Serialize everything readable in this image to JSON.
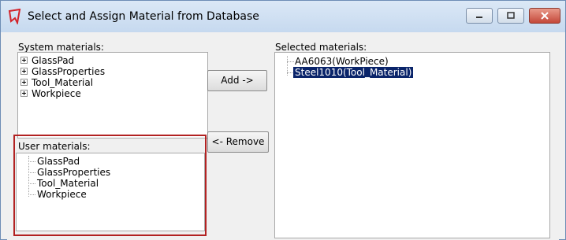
{
  "window": {
    "title": "Select and Assign Material from Database"
  },
  "system_panel": {
    "label": "System materials:",
    "items": [
      {
        "label": "GlassPad"
      },
      {
        "label": "GlassProperties"
      },
      {
        "label": "Tool_Material"
      },
      {
        "label": "Workpiece"
      }
    ]
  },
  "user_panel": {
    "label": "User materials:",
    "items": [
      {
        "label": "GlassPad"
      },
      {
        "label": "GlassProperties"
      },
      {
        "label": "Tool_Material"
      },
      {
        "label": "Workpiece"
      }
    ]
  },
  "actions": {
    "add_label": "Add ->",
    "remove_label": "<- Remove"
  },
  "selected_panel": {
    "label": "Selected materials:",
    "items": [
      {
        "label": "AA6063(WorkPiece)",
        "selected": false
      },
      {
        "label": "Steel1010(Tool_Material)",
        "selected": true
      }
    ]
  },
  "colors": {
    "highlight_frame": "#b22222",
    "selection": "#0a246a"
  }
}
